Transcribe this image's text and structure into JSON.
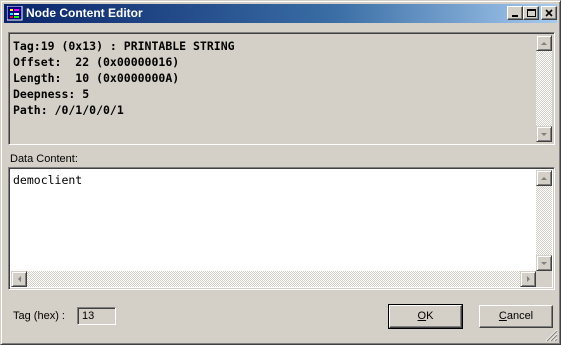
{
  "window": {
    "title": "Node Content Editor"
  },
  "info": {
    "lines": [
      "Tag:19 (0x13) : PRINTABLE STRING",
      "Offset:  22 (0x00000016)",
      "Length:  10 (0x0000000A)",
      "Deepness: 5",
      "Path: /0/1/0/0/1"
    ]
  },
  "data_content": {
    "label": "Data Content:",
    "value": "democlient"
  },
  "tag_hex": {
    "label": "Tag (hex) :",
    "value": "13"
  },
  "buttons": {
    "ok_accel": "O",
    "ok_rest": "K",
    "cancel_accel": "C",
    "cancel_rest": "ancel"
  }
}
